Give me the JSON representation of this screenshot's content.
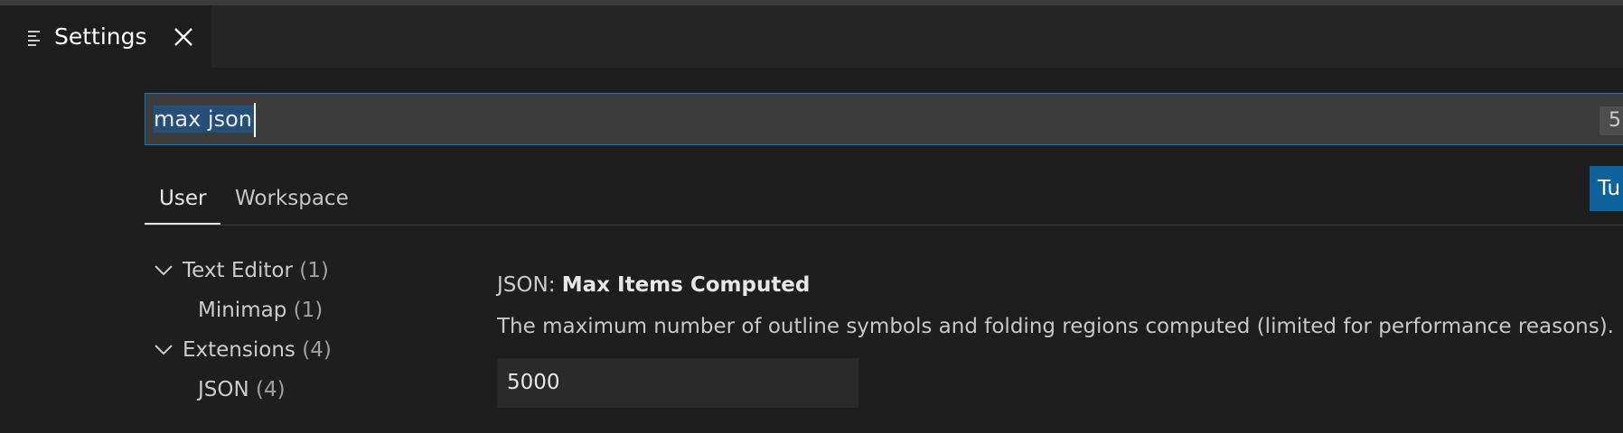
{
  "editor_tab": {
    "title": "Settings",
    "icon": "settings-list-icon",
    "close_icon": "close-icon"
  },
  "search": {
    "value": "max json",
    "result_count": "5"
  },
  "scope_tabs": [
    {
      "label": "User",
      "active": true
    },
    {
      "label": "Workspace",
      "active": false
    }
  ],
  "turn_on_button": {
    "label": "Tu"
  },
  "toc": [
    {
      "label": "Text Editor",
      "count": "(1)",
      "level": 0,
      "expanded": true
    },
    {
      "label": "Minimap",
      "count": "(1)",
      "level": 1
    },
    {
      "label": "Extensions",
      "count": "(4)",
      "level": 0,
      "expanded": true
    },
    {
      "label": "JSON",
      "count": "(4)",
      "level": 1
    }
  ],
  "setting": {
    "category": "JSON: ",
    "name": "Max Items Computed",
    "description": "The maximum number of outline symbols and folding regions computed (limited for performance reasons).",
    "value": "5000"
  },
  "colors": {
    "accent": "#007fd4",
    "button": "#0e639c",
    "selection": "#264f78",
    "background": "#1e1e1e"
  }
}
